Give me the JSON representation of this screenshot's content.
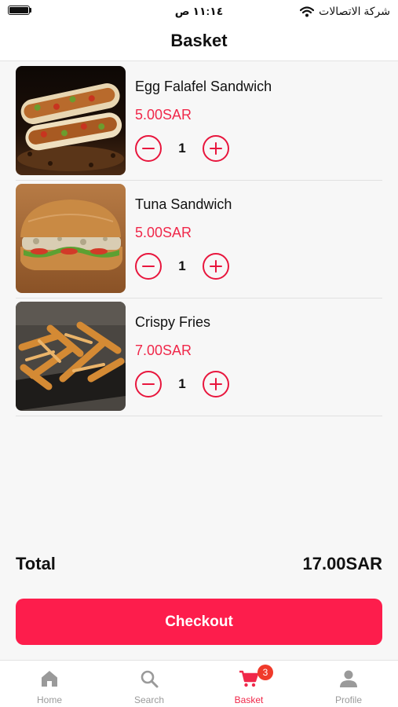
{
  "status_bar": {
    "time": "١١:١٤ ص",
    "carrier": "شركة الاتصالات"
  },
  "header": {
    "title": "Basket"
  },
  "items": [
    {
      "name": "Egg Falafel Sandwich",
      "price": "5.00SAR",
      "quantity": "1"
    },
    {
      "name": "Tuna Sandwich",
      "price": "5.00SAR",
      "quantity": "1"
    },
    {
      "name": "Crispy Fries",
      "price": "7.00SAR",
      "quantity": "1"
    }
  ],
  "summary": {
    "total_label": "Total",
    "total_value": "17.00SAR"
  },
  "checkout": {
    "label": "Checkout"
  },
  "tabs": [
    {
      "label": "Home",
      "icon": "home-icon",
      "active": false
    },
    {
      "label": "Search",
      "icon": "search-icon",
      "active": false
    },
    {
      "label": "Basket",
      "icon": "cart-icon",
      "active": true,
      "badge": "3"
    },
    {
      "label": "Profile",
      "icon": "profile-icon",
      "active": false
    }
  ],
  "colors": {
    "accent": "#fd1d4c",
    "price": "#f0284a",
    "badge": "#f03a2a",
    "inactive_tab": "#9a9a9a"
  }
}
